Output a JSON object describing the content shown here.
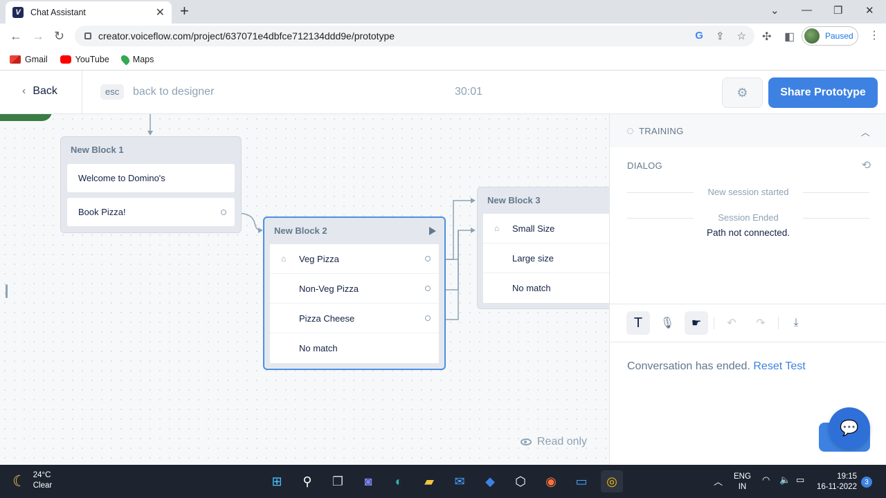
{
  "browser": {
    "tab_title": "Chat Assistant",
    "tab_favicon_letter": "V",
    "url": "creator.voiceflow.com/project/637071e4dbfce712134ddd9e/prototype",
    "profile_status": "Paused",
    "bookmarks": [
      "Gmail",
      "YouTube",
      "Maps"
    ]
  },
  "header": {
    "back_label": "Back",
    "esc_key": "esc",
    "back_to_designer": "back to designer",
    "timer": "30:01",
    "share_label": "Share Prototype"
  },
  "canvas": {
    "blocks": [
      {
        "title": "New Block 1",
        "steps": [
          "Welcome to Domino's",
          "Book Pizza!"
        ]
      },
      {
        "title": "New Block 2",
        "steps": [
          "Veg Pizza",
          "Non-Veg Pizza",
          "Pizza Cheese",
          "No match"
        ]
      },
      {
        "title": "New Block 3",
        "steps": [
          "Small Size",
          "Large size",
          "No match"
        ]
      }
    ],
    "read_only_label": "Read only"
  },
  "panel": {
    "training_label": "TRAINING",
    "dialog_label": "DIALOG",
    "session_started": "New session started",
    "session_ended": "Session Ended",
    "path_message": "Path not connected.",
    "conversation_ended": "Conversation has ended.",
    "reset_label": "Reset Test"
  },
  "taskbar": {
    "temperature": "24°C",
    "weather": "Clear",
    "lang_top": "ENG",
    "lang_bottom": "IN",
    "time": "19:15",
    "date": "16-11-2022",
    "notification_count": "3"
  },
  "colors": {
    "accent": "#3d82e2",
    "selected_block_border": "#4a90e2",
    "start_block": "#3a7d44"
  }
}
